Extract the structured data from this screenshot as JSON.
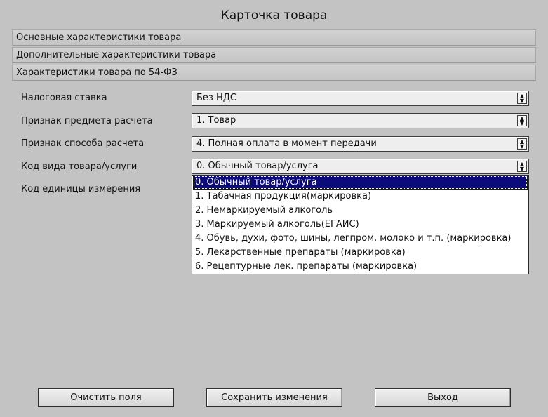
{
  "window": {
    "title": "Карточка товара"
  },
  "sections": [
    {
      "label": "Основные характеристики товара"
    },
    {
      "label": "Дополнительные характеристики товара"
    },
    {
      "label": "Характеристики товара по 54-ФЗ"
    }
  ],
  "form": {
    "tax_rate": {
      "label": "Налоговая ставка",
      "value": "Без НДС"
    },
    "payment_subject": {
      "label": "Признак предмета расчета",
      "value": "1. Товар"
    },
    "payment_method": {
      "label": "Признак способа расчета",
      "value": "4. Полная оплата в момент передачи"
    },
    "goods_type": {
      "label": "Код вида товара/услуги",
      "value": "0. Обычный товар/услуга"
    },
    "unit_code": {
      "label": "Код единицы измерения"
    }
  },
  "dropdown": {
    "options": [
      "0. Обычный товар/услуга",
      "1. Табачная продукция(маркировка)",
      "2. Немаркируемый алкоголь",
      "3. Маркируемый алкоголь(ЕГАИС)",
      "4. Обувь, духи, фото, шины, легпром, молоко и т.п. (маркировка)",
      "5. Лекарственные препараты (маркировка)",
      "6. Рецептурные лек. препараты (маркировка)"
    ],
    "selected_index": 0
  },
  "buttons": {
    "clear": "Очистить поля",
    "save": "Сохранить изменения",
    "exit": "Выход"
  },
  "colors": {
    "background": "#c3c3c3",
    "selection": "#0b0b7a"
  }
}
